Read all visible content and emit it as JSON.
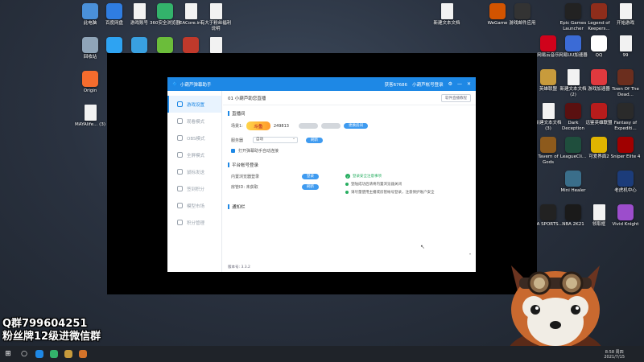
{
  "desktop_icons_left": [
    {
      "label": "此电脑",
      "color": "#4a90d9",
      "icon": "computer-icon"
    },
    {
      "label": "百度网盘",
      "color": "#2f7de1",
      "icon": "cloud-icon"
    },
    {
      "label": "游戏账号",
      "color": "#f2f2f2",
      "icon": "doc-icon"
    },
    {
      "label": "360安全浏览器",
      "color": "#33b36b",
      "icon": "browser-icon"
    },
    {
      "label": "EACore.ini",
      "color": "#f2f2f2",
      "icon": "doc-icon"
    },
    {
      "label": "有大于粉丝福利说明",
      "color": "#f2f2f2",
      "icon": "doc-icon"
    }
  ],
  "desktop_icons_row2": [
    {
      "label": "回收站",
      "color": "#8fa4b8",
      "icon": "recycle-bin-icon"
    },
    {
      "label": "",
      "color": "#2ea3f2",
      "icon": "play-icon"
    },
    {
      "label": "",
      "color": "#39a0e0",
      "icon": "bird-icon"
    },
    {
      "label": "",
      "color": "#6bbd3a",
      "icon": "nvidia-icon"
    },
    {
      "label": "",
      "color": "#c0392b",
      "icon": "app-icon"
    },
    {
      "label": "",
      "color": "#f2f2f2",
      "icon": "doc-icon"
    }
  ],
  "desktop_icons_left_col": [
    {
      "label": "Origin",
      "color": "#f56c2d",
      "icon": "origin-icon"
    },
    {
      "label": "MAYAlife... (3)",
      "color": "#f2f2f2",
      "icon": "doc-icon"
    }
  ],
  "desktop_icons_top_mid": [
    {
      "label": "新建文本文档",
      "color": "#f2f2f2",
      "icon": "doc-icon"
    }
  ],
  "desktop_icons_right": [
    {
      "label": "WeGame",
      "color": "#d35400",
      "icon": "wegame-icon"
    },
    {
      "label": "游戏邮件应用",
      "color": "#333333",
      "icon": "game-icon"
    },
    {
      "label": "Epic Games Launcher",
      "color": "#222222",
      "icon": "epic-icon"
    },
    {
      "label": "Legend of Keepers...",
      "color": "#8e2d1b",
      "icon": "game-icon"
    },
    {
      "label": "开始游戏",
      "color": "#f2f2f2",
      "icon": "doc-icon"
    },
    {
      "label": "网易云音乐",
      "color": "#d0021b",
      "icon": "music-icon"
    },
    {
      "label": "网易UU加速器",
      "color": "#3b6bd6",
      "icon": "uu-icon"
    },
    {
      "label": "QQ",
      "color": "#ffffff",
      "icon": "qq-icon"
    },
    {
      "label": "99",
      "color": "#f2f2f2",
      "icon": "doc-icon"
    },
    {
      "label": "英雄联盟",
      "color": "#c89b3c",
      "icon": "lol-icon"
    },
    {
      "label": "新建文本文档 (2)",
      "color": "#f2f2f2",
      "icon": "doc-icon"
    },
    {
      "label": "游戏加速器",
      "color": "#e0393e",
      "icon": "game-icon"
    },
    {
      "label": "Town Of The Dead...",
      "color": "#6b2e1e",
      "icon": "game-icon"
    },
    {
      "label": "新建文本文档 (3)",
      "color": "#f2f2f2",
      "icon": "doc-icon"
    },
    {
      "label": "Dark Deception",
      "color": "#5a1010",
      "icon": "game-icon"
    },
    {
      "label": "远鉴英雄联盟",
      "color": "#b71c1c",
      "icon": "game-icon"
    },
    {
      "label": "Fantasy of Expediti...",
      "color": "#2a2a2a",
      "icon": "game-icon"
    },
    {
      "label": "Tavern of Gods",
      "color": "#8d5a1c",
      "icon": "game-icon"
    },
    {
      "label": "LeagueCli...",
      "color": "#1f4e3d",
      "icon": "game-icon"
    },
    {
      "label": "可爱界面2",
      "color": "#e0b400",
      "icon": "game-icon"
    },
    {
      "label": "Sniper Elite 4",
      "color": "#a00000",
      "icon": "game-icon"
    },
    {
      "label": "Mini Healer",
      "color": "#3a6e8a",
      "icon": "game-icon"
    },
    {
      "label": "老虎机中心",
      "color": "#1c3c7a",
      "icon": "game-icon"
    },
    {
      "label": "EA SPORTS...",
      "color": "#222222",
      "icon": "game-icon"
    },
    {
      "label": "NBA 2K21",
      "color": "#1a1a1a",
      "icon": "game-icon"
    },
    {
      "label": "领取框",
      "color": "#f2f2f2",
      "icon": "doc-icon"
    },
    {
      "label": "Vivid Knight",
      "color": "#9c4dcc",
      "icon": "game-icon"
    }
  ],
  "window": {
    "title": "小葫芦弹幕助手",
    "title_right_1": "获客67686",
    "title_right_2": "小葫芦帐号登录",
    "sidebar": [
      {
        "label": "游戏设置",
        "active": true,
        "icon": "settings-icon"
      },
      {
        "label": "观看模式",
        "active": false,
        "icon": "eye-icon"
      },
      {
        "label": "OBS模式",
        "active": false,
        "icon": "obs-icon"
      },
      {
        "label": "全屏模式",
        "active": false,
        "icon": "fullscreen-icon"
      },
      {
        "label": "鼠标发送",
        "active": false,
        "icon": "mouse-icon"
      },
      {
        "label": "签到积分",
        "active": false,
        "icon": "calendar-icon"
      },
      {
        "label": "模型市场",
        "active": false,
        "icon": "market-icon"
      },
      {
        "label": "积分管理",
        "active": false,
        "icon": "points-icon"
      }
    ],
    "main_title": "01 小葫芦助您直播",
    "help_button": "软件直播教程",
    "section_live": "直播间",
    "room_label": "场景1:",
    "platform_logo": "斗鱼",
    "room_id": "249813",
    "btn_gray_1": "",
    "btn_gray_2": "",
    "btn_change_room": "更换房间",
    "server_label": "服务器",
    "server_value": "自动",
    "refresh_button": "刷新",
    "checkbox_label": "打开弹幕助手自动连接",
    "section_account": "平台帐号登录",
    "account_row_1": "内置浏览器登录",
    "account_btn_1": "登录",
    "account_row_2": "房管ID: 未获取",
    "account_btn_2": "刷新",
    "tip_header": "登录安全注意事项",
    "tips": [
      "登陆成功后请将内置浏览器关闭",
      "请尽量使用主播或房管帐号登录，注意保护账户安全"
    ],
    "section_notify": "通知栏",
    "version": "版本号: 3.3.2"
  },
  "stream_overlay": {
    "line1": "Q群799604251",
    "line2": "粉丝牌12级进微信群"
  },
  "taskbar": {
    "time": "8:58 周四",
    "date": "2021/7/15"
  }
}
